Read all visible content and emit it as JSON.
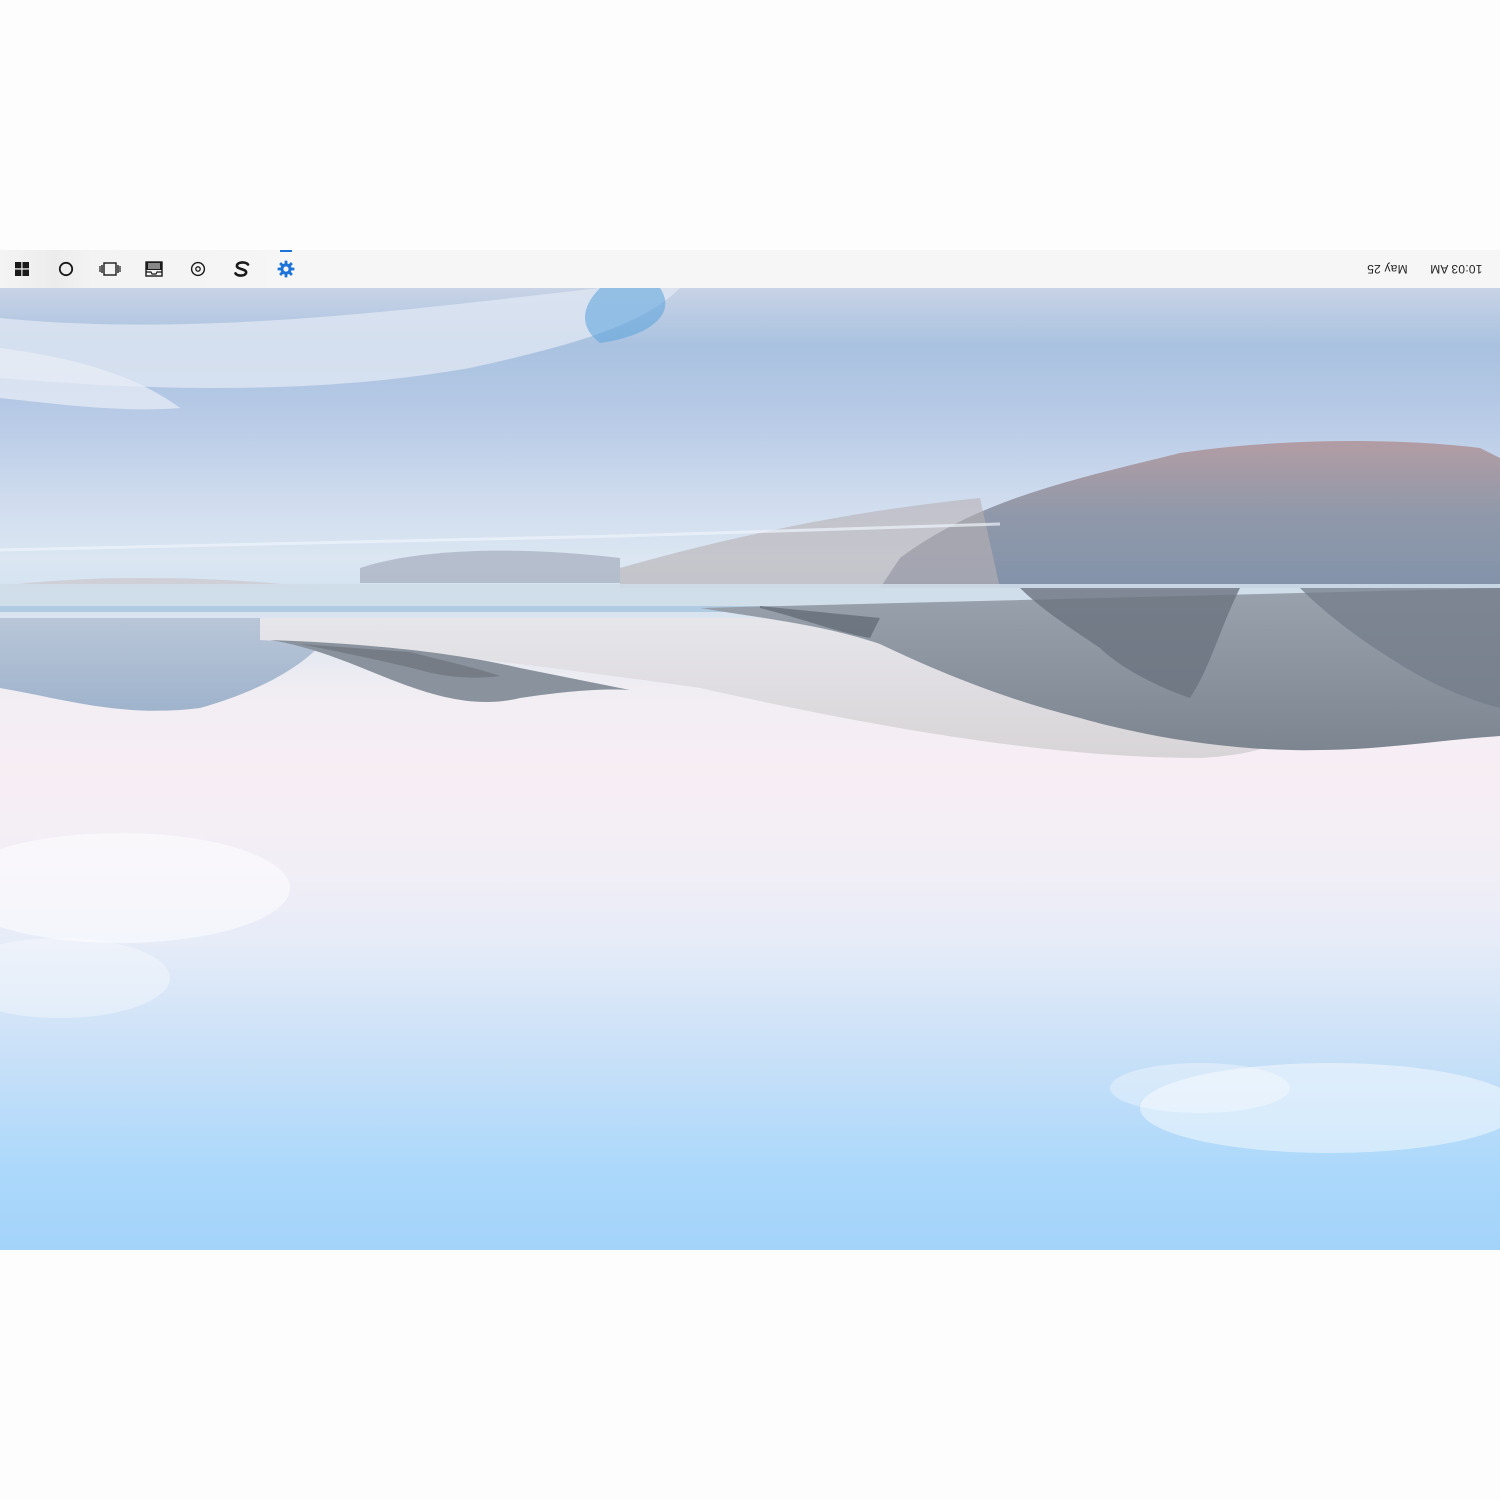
{
  "taskbar": {
    "items": [
      {
        "name": "start-button",
        "icon": "windows-logo-icon"
      },
      {
        "name": "search-button",
        "icon": "cortana-circle-icon"
      },
      {
        "name": "task-view-button",
        "icon": "task-view-icon"
      },
      {
        "name": "file-explorer-button",
        "icon": "tray-inbox-icon"
      },
      {
        "name": "media-app-button",
        "icon": "disc-icon"
      },
      {
        "name": "app-s-button",
        "icon": "s-logo-icon"
      },
      {
        "name": "settings-button",
        "icon": "gear-icon",
        "active": true
      }
    ],
    "accent_color": "#1e73d8",
    "clock": {
      "date": "May 25",
      "time": "10:03 AM"
    }
  }
}
